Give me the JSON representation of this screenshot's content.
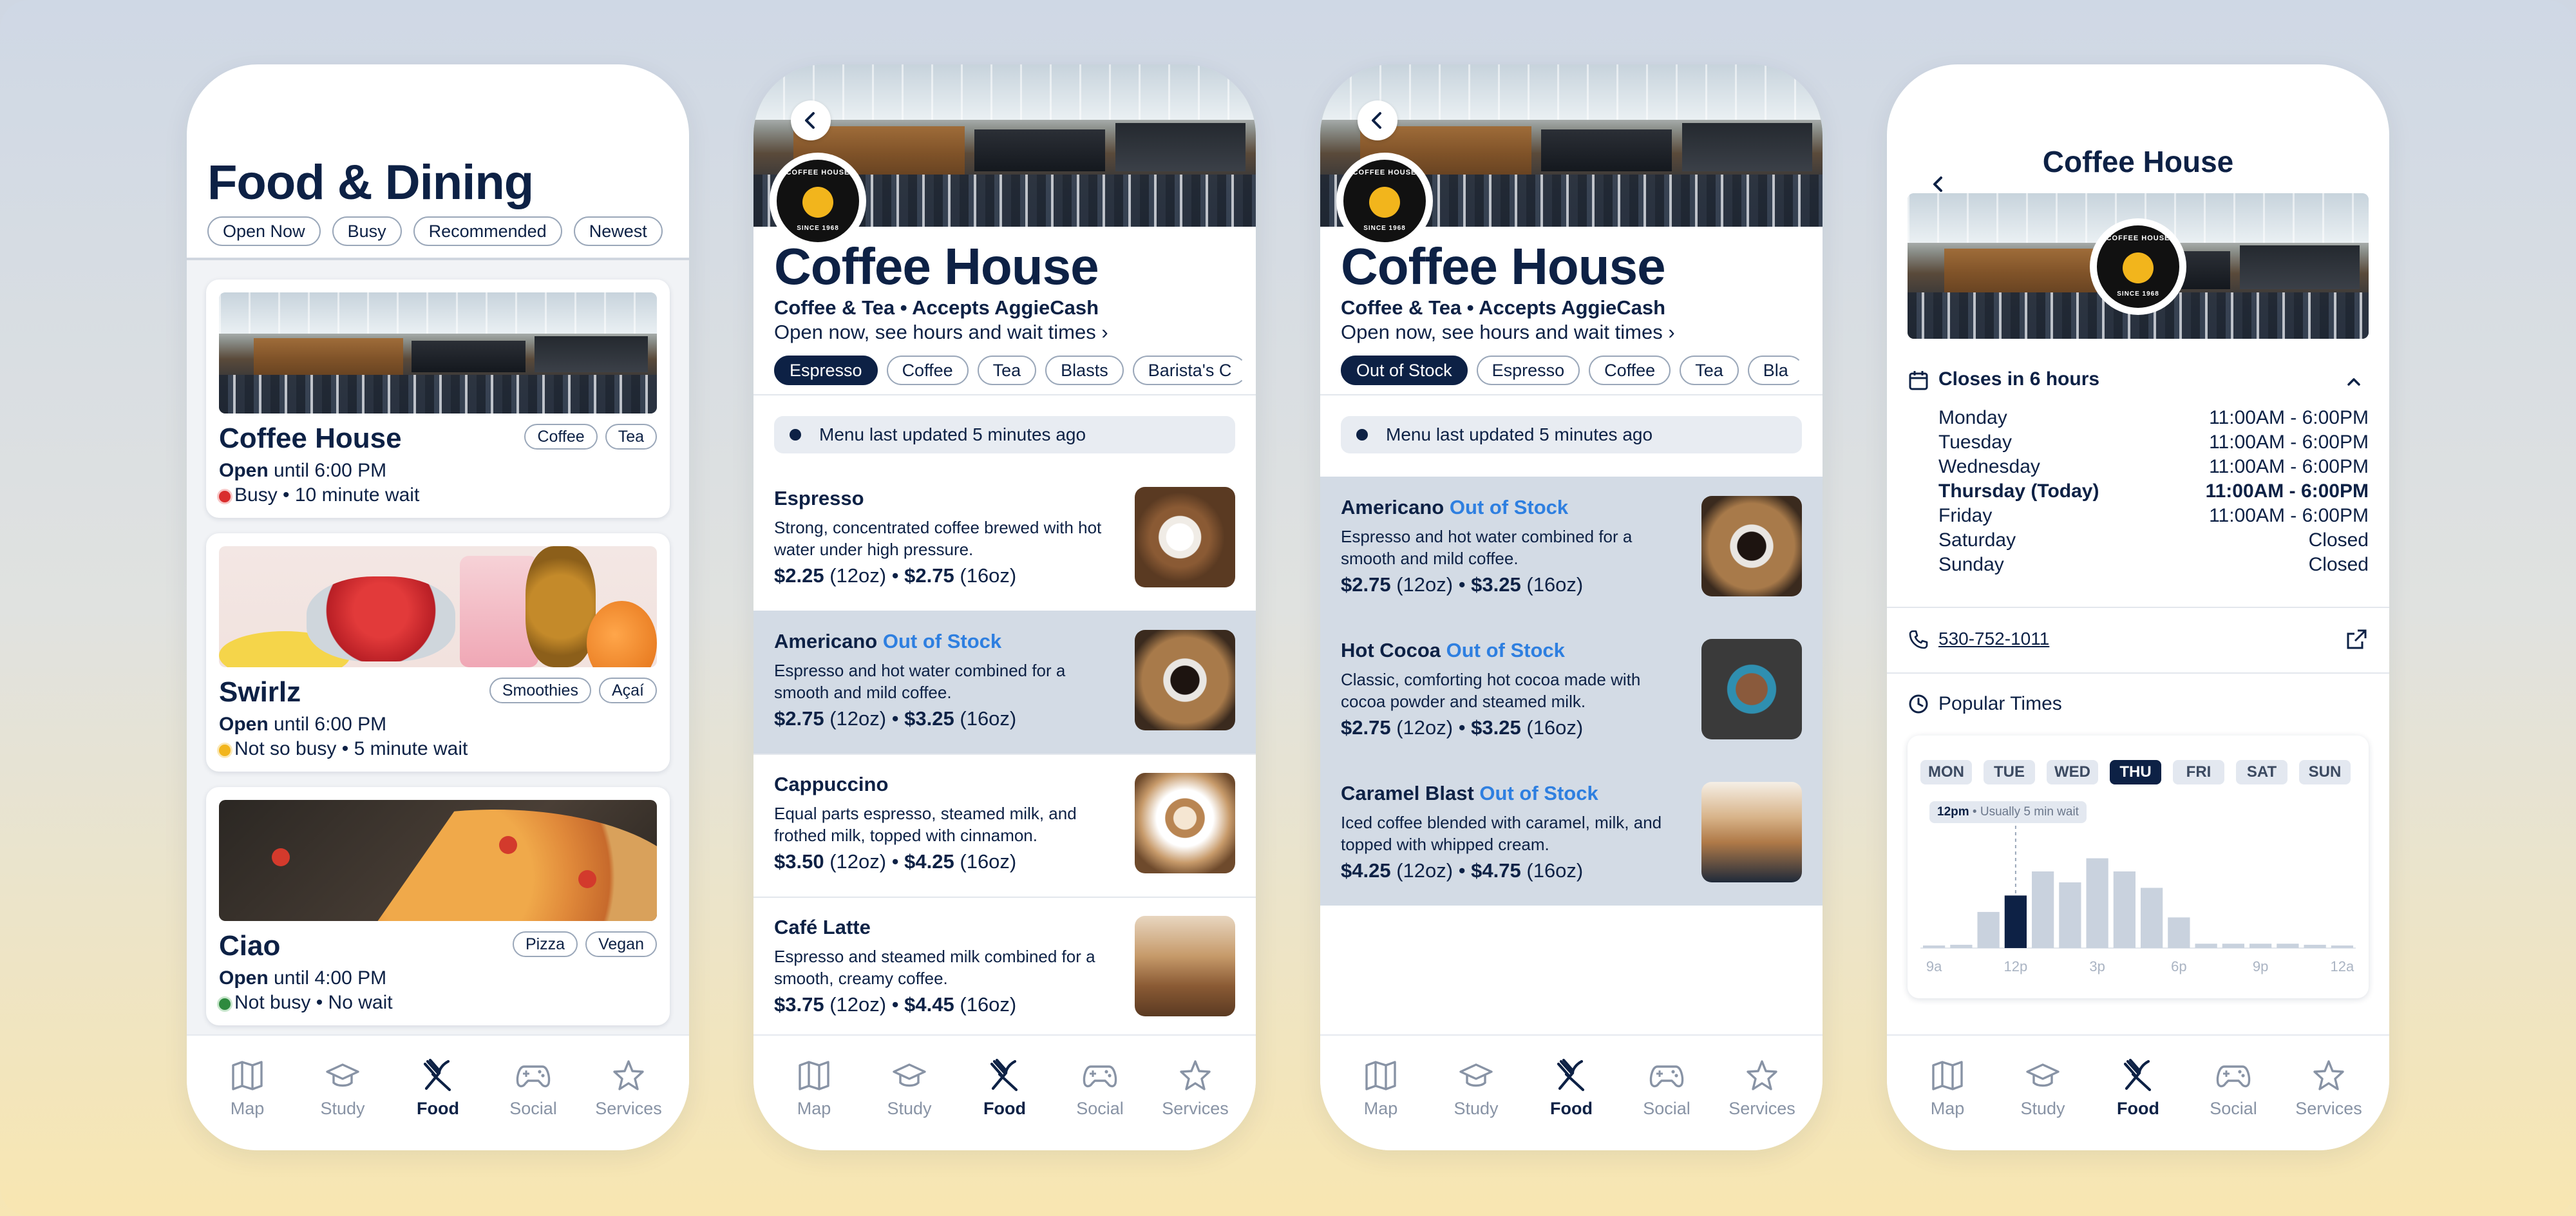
{
  "nav": [
    {
      "label": "Map",
      "icon": "map-icon"
    },
    {
      "label": "Study",
      "icon": "graduation-cap-icon"
    },
    {
      "label": "Food",
      "icon": "fork-knife-icon"
    },
    {
      "label": "Social",
      "icon": "gamepad-icon"
    },
    {
      "label": "Services",
      "icon": "star-icon"
    }
  ],
  "colors": {
    "navy": "#0d2145",
    "out_of_stock": "#2e7fe0",
    "busy": "#d92d2d",
    "medium": "#f2b51c",
    "quiet": "#2e8a3e"
  },
  "list_screen": {
    "title": "Food & Dining",
    "filters": [
      "Open Now",
      "Busy",
      "Recommended",
      "Newest"
    ],
    "places": [
      {
        "name": "Coffee House",
        "tags": [
          "Coffee",
          "Tea"
        ],
        "open_label": "Open",
        "hours": "until 6:00 PM",
        "busy": "Busy • 10 minute wait",
        "busy_color": "#d92d2d"
      },
      {
        "name": "Swirlz",
        "tags": [
          "Smoothies",
          "Açaí"
        ],
        "open_label": "Open",
        "hours": "until 6:00 PM",
        "busy": "Not so busy • 5 minute wait",
        "busy_color": "#f2b51c"
      },
      {
        "name": "Ciao",
        "tags": [
          "Pizza",
          "Vegan"
        ],
        "open_label": "Open",
        "hours": "until 4:00 PM",
        "busy": "Not busy • No wait",
        "busy_color": "#2e8a3e"
      }
    ]
  },
  "shop": {
    "name": "Coffee House",
    "subtitle": "Coffee & Tea • Accepts AggieCash",
    "open_link": "Open now, see hours and wait times",
    "logo_top": "COFFEE HOUSE",
    "logo_bottom": "SINCE 1968",
    "notice": "Menu last updated 5 minutes ago"
  },
  "menu_screen": {
    "tabs": [
      "Espresso",
      "Coffee",
      "Tea",
      "Blasts",
      "Barista's C"
    ],
    "items": [
      {
        "name": "Espresso",
        "oos": "",
        "desc": "Strong, concentrated coffee brewed with hot water under high pressure.",
        "p1": "$2.25",
        "s1": "(12oz)",
        "p2": "$2.75",
        "s2": "(16oz)"
      },
      {
        "name": "Americano",
        "oos": "Out of Stock",
        "desc": "Espresso and hot water combined for a smooth and mild coffee.",
        "p1": "$2.75",
        "s1": "(12oz)",
        "p2": "$3.25",
        "s2": "(16oz)"
      },
      {
        "name": "Cappuccino",
        "oos": "",
        "desc": "Equal parts espresso, steamed milk, and frothed milk, topped with cinnamon.",
        "p1": "$3.50",
        "s1": "(12oz)",
        "p2": "$4.25",
        "s2": "(16oz)"
      },
      {
        "name": "Café Latte",
        "oos": "",
        "desc": "Espresso and steamed milk combined for a smooth, creamy coffee.",
        "p1": "$3.75",
        "s1": "(12oz)",
        "p2": "$4.45",
        "s2": "(16oz)"
      }
    ]
  },
  "oos_screen": {
    "tabs": [
      "Out of Stock",
      "Espresso",
      "Coffee",
      "Tea",
      "Bla"
    ],
    "items": [
      {
        "name": "Americano",
        "oos": "Out of Stock",
        "desc": "Espresso and hot water combined for a smooth and mild coffee.",
        "p1": "$2.75",
        "s1": "(12oz)",
        "p2": "$3.25",
        "s2": "(16oz)"
      },
      {
        "name": "Hot Cocoa",
        "oos": "Out of Stock",
        "desc": "Classic, comforting hot cocoa made with cocoa powder and steamed milk.",
        "p1": "$2.75",
        "s1": "(12oz)",
        "p2": "$3.25",
        "s2": "(16oz)"
      },
      {
        "name": "Caramel Blast",
        "oos": "Out of Stock",
        "desc": "Iced coffee blended with caramel, milk, and topped with whipped cream.",
        "p1": "$4.25",
        "s1": "(12oz)",
        "p2": "$4.75",
        "s2": "(16oz)"
      }
    ]
  },
  "detail_screen": {
    "title": "Coffee House",
    "closes": "Closes in 6 hours",
    "hours": [
      {
        "day": "Monday",
        "time": "11:00AM - 6:00PM"
      },
      {
        "day": "Tuesday",
        "time": "11:00AM - 6:00PM"
      },
      {
        "day": "Wednesday",
        "time": "11:00AM - 6:00PM"
      },
      {
        "day": "Thursday (Today)",
        "time": "11:00AM - 6:00PM",
        "today": true
      },
      {
        "day": "Friday",
        "time": "11:00AM - 6:00PM"
      },
      {
        "day": "Saturday",
        "time": "Closed"
      },
      {
        "day": "Sunday",
        "time": "Closed"
      }
    ],
    "phone": "530-752-1011",
    "popular_title": "Popular Times",
    "days": [
      "MON",
      "TUE",
      "WED",
      "THU",
      "FRI",
      "SAT",
      "SUN"
    ],
    "active_day": "THU",
    "tooltip_time": "12pm",
    "tooltip_text": "• Usually 5 min wait"
  },
  "chart_data": {
    "type": "bar",
    "categories": [
      "9a",
      "10a",
      "11a",
      "12p",
      "1p",
      "2p",
      "3p",
      "4p",
      "5p",
      "6p",
      "7p",
      "8p",
      "9p",
      "10p",
      "11p",
      "12a"
    ],
    "values": [
      0.02,
      0.03,
      0.33,
      0.48,
      0.7,
      0.6,
      0.82,
      0.7,
      0.55,
      0.28,
      0.04,
      0.04,
      0.04,
      0.04,
      0.03,
      0.02
    ],
    "highlight_index": 3,
    "tick_labels": [
      "9a",
      "12p",
      "3p",
      "6p",
      "9p",
      "12a"
    ],
    "ylim": [
      0,
      1
    ]
  }
}
